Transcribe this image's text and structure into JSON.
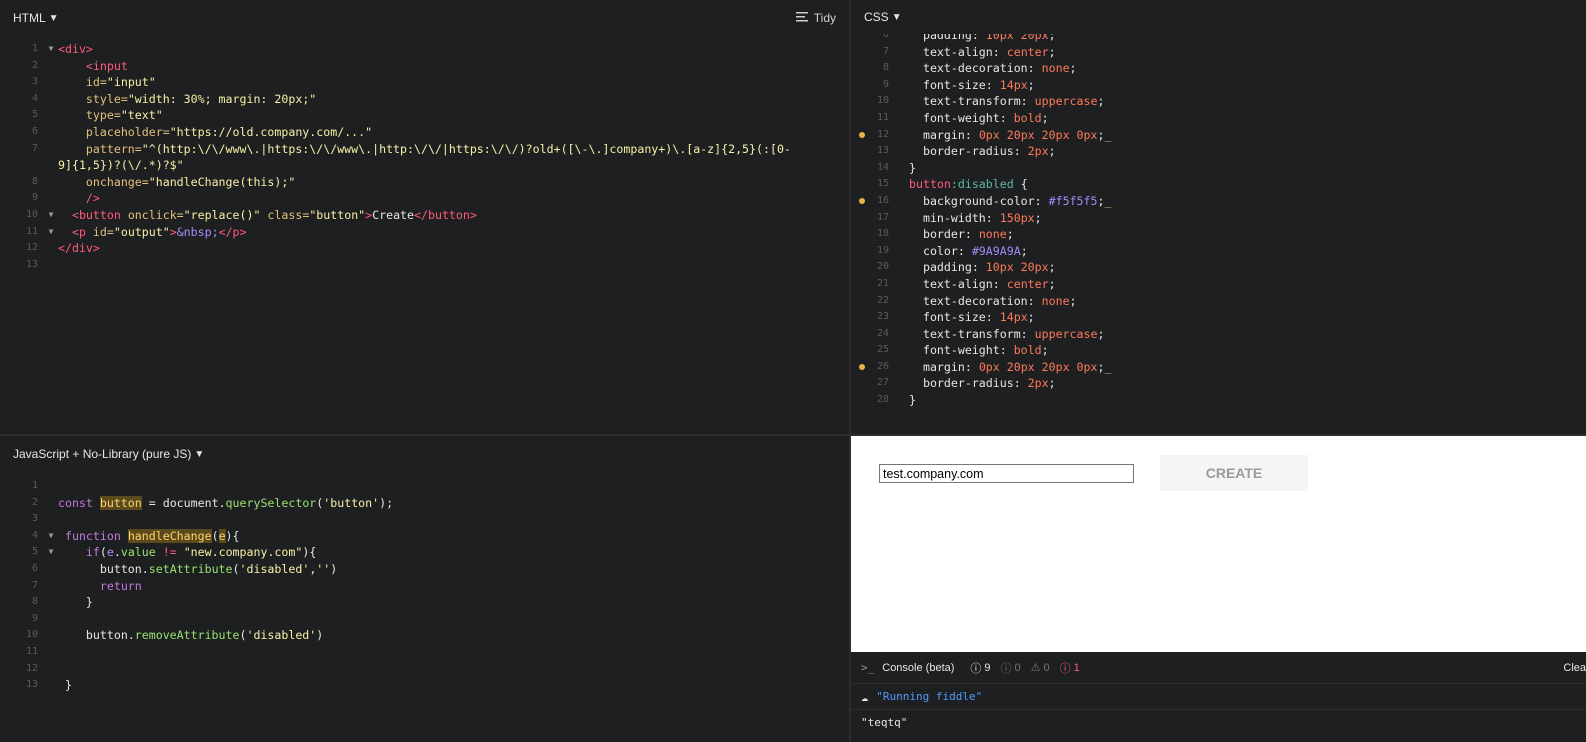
{
  "panels": {
    "html": {
      "title": "HTML",
      "tidy": "Tidy"
    },
    "css": {
      "title": "CSS"
    },
    "js": {
      "title": "JavaScript + No-Library (pure JS)"
    }
  },
  "html_code": [
    {
      "n": "1",
      "fold": true,
      "tokens": [
        [
          "tag",
          "<div"
        ],
        [
          "tag",
          ">"
        ]
      ]
    },
    {
      "n": "2",
      "tokens": [
        [
          "txt",
          "    "
        ],
        [
          "tag",
          "<input"
        ]
      ]
    },
    {
      "n": "3",
      "tokens": [
        [
          "txt",
          "    "
        ],
        [
          "attr",
          "id="
        ],
        [
          "str",
          "\"input\""
        ]
      ]
    },
    {
      "n": "4",
      "tokens": [
        [
          "txt",
          "    "
        ],
        [
          "attr",
          "style="
        ],
        [
          "str",
          "\"width: 30%; margin: 20px;\""
        ]
      ]
    },
    {
      "n": "5",
      "tokens": [
        [
          "txt",
          "    "
        ],
        [
          "attr",
          "type="
        ],
        [
          "str",
          "\"text\""
        ]
      ]
    },
    {
      "n": "6",
      "tokens": [
        [
          "txt",
          "    "
        ],
        [
          "attr",
          "placeholder="
        ],
        [
          "str",
          "\"https://old.company.com/...\""
        ]
      ]
    },
    {
      "n": "7",
      "tokens": [
        [
          "txt",
          "    "
        ],
        [
          "attr",
          "pattern="
        ],
        [
          "str",
          "\"^(http:\\/\\/www\\.|https:\\/\\/www\\.|http:\\/\\/|https:\\/\\/)?old+([\\-\\.]company+)\\.[a-z]{2,5}(:[0-"
        ]
      ]
    },
    {
      "n": "",
      "tokens": [
        [
          "str",
          "9]{1,5})?(\\/.*)?$\""
        ]
      ]
    },
    {
      "n": "8",
      "tokens": [
        [
          "txt",
          "    "
        ],
        [
          "attr",
          "onchange="
        ],
        [
          "str",
          "\"handleChange(this);\""
        ]
      ]
    },
    {
      "n": "9",
      "tokens": [
        [
          "txt",
          "    "
        ],
        [
          "tag",
          "/>"
        ]
      ]
    },
    {
      "n": "10",
      "fold": true,
      "tokens": [
        [
          "txt",
          "  "
        ],
        [
          "tag",
          "<button "
        ],
        [
          "attr",
          "onclick="
        ],
        [
          "str",
          "\"replace()\" "
        ],
        [
          "attr",
          "class="
        ],
        [
          "str",
          "\"button\""
        ],
        [
          "tag",
          ">"
        ],
        [
          "txt",
          "Create"
        ],
        [
          "tag",
          "</button>"
        ]
      ]
    },
    {
      "n": "11",
      "fold": true,
      "tokens": [
        [
          "txt",
          "  "
        ],
        [
          "tag",
          "<p "
        ],
        [
          "attr",
          "id="
        ],
        [
          "str",
          "\"output\""
        ],
        [
          "tag",
          ">"
        ],
        [
          "ent",
          "&nbsp;"
        ],
        [
          "tag",
          "</p>"
        ]
      ]
    },
    {
      "n": "12",
      "tokens": [
        [
          "tag",
          "</div>"
        ]
      ]
    },
    {
      "n": "13",
      "tokens": []
    }
  ],
  "css_code": [
    {
      "n": "6",
      "tokens": [
        [
          "prop",
          "  padding: "
        ],
        [
          "num",
          "10px 20px"
        ],
        [
          "txt",
          ";"
        ]
      ]
    },
    {
      "n": "7",
      "tokens": [
        [
          "prop",
          "  text-align: "
        ],
        [
          "val",
          "center"
        ],
        [
          "txt",
          ";"
        ]
      ]
    },
    {
      "n": "8",
      "tokens": [
        [
          "prop",
          "  text-decoration: "
        ],
        [
          "val",
          "none"
        ],
        [
          "txt",
          ";"
        ]
      ]
    },
    {
      "n": "9",
      "tokens": [
        [
          "prop",
          "  font-size: "
        ],
        [
          "num",
          "14px"
        ],
        [
          "txt",
          ";"
        ]
      ]
    },
    {
      "n": "10",
      "tokens": [
        [
          "prop",
          "  text-transform: "
        ],
        [
          "val",
          "uppercase"
        ],
        [
          "txt",
          ";"
        ]
      ]
    },
    {
      "n": "11",
      "tokens": [
        [
          "prop",
          "  font-weight: "
        ],
        [
          "val",
          "bold"
        ],
        [
          "txt",
          ";"
        ]
      ]
    },
    {
      "n": "12",
      "dot": true,
      "tokens": [
        [
          "prop",
          "  margin: "
        ],
        [
          "num",
          "0px 20px 20px 0px"
        ],
        [
          "txt",
          ";"
        ],
        [
          "attr",
          "_"
        ]
      ]
    },
    {
      "n": "13",
      "tokens": [
        [
          "prop",
          "  border-radius: "
        ],
        [
          "num",
          "2px"
        ],
        [
          "txt",
          ";"
        ]
      ]
    },
    {
      "n": "14",
      "tokens": [
        [
          "txt",
          "}"
        ]
      ]
    },
    {
      "n": "15",
      "tokens": [
        [
          "tag",
          "button"
        ],
        [
          "pseudo",
          ":disabled"
        ],
        [
          "txt",
          " {"
        ]
      ]
    },
    {
      "n": "16",
      "dot": true,
      "tokens": [
        [
          "prop",
          "  background-color: "
        ],
        [
          "ent",
          "#f5f5f5"
        ],
        [
          "txt",
          ";"
        ],
        [
          "attr",
          "_"
        ]
      ]
    },
    {
      "n": "17",
      "tokens": [
        [
          "prop",
          "  min-width: "
        ],
        [
          "num",
          "150px"
        ],
        [
          "txt",
          ";"
        ]
      ]
    },
    {
      "n": "18",
      "tokens": [
        [
          "prop",
          "  border: "
        ],
        [
          "val",
          "none"
        ],
        [
          "txt",
          ";"
        ]
      ]
    },
    {
      "n": "19",
      "tokens": [
        [
          "prop",
          "  color: "
        ],
        [
          "ent",
          "#9A9A9A"
        ],
        [
          "txt",
          ";"
        ]
      ]
    },
    {
      "n": "20",
      "tokens": [
        [
          "prop",
          "  padding: "
        ],
        [
          "num",
          "10px 20px"
        ],
        [
          "txt",
          ";"
        ]
      ]
    },
    {
      "n": "21",
      "tokens": [
        [
          "prop",
          "  text-align: "
        ],
        [
          "val",
          "center"
        ],
        [
          "txt",
          ";"
        ]
      ]
    },
    {
      "n": "22",
      "tokens": [
        [
          "prop",
          "  text-decoration: "
        ],
        [
          "val",
          "none"
        ],
        [
          "txt",
          ";"
        ]
      ]
    },
    {
      "n": "23",
      "tokens": [
        [
          "prop",
          "  font-size: "
        ],
        [
          "num",
          "14px"
        ],
        [
          "txt",
          ";"
        ]
      ]
    },
    {
      "n": "24",
      "tokens": [
        [
          "prop",
          "  text-transform: "
        ],
        [
          "val",
          "uppercase"
        ],
        [
          "txt",
          ";"
        ]
      ]
    },
    {
      "n": "25",
      "tokens": [
        [
          "prop",
          "  font-weight: "
        ],
        [
          "val",
          "bold"
        ],
        [
          "txt",
          ";"
        ]
      ]
    },
    {
      "n": "26",
      "dot": true,
      "tokens": [
        [
          "prop",
          "  margin: "
        ],
        [
          "num",
          "0px 20px 20px 0px"
        ],
        [
          "txt",
          ";"
        ],
        [
          "attr",
          "_"
        ]
      ]
    },
    {
      "n": "27",
      "tokens": [
        [
          "prop",
          "  border-radius: "
        ],
        [
          "num",
          "2px"
        ],
        [
          "txt",
          ";"
        ]
      ]
    },
    {
      "n": "28",
      "tokens": [
        [
          "txt",
          "}"
        ]
      ]
    }
  ],
  "js_code": [
    {
      "n": "1",
      "tokens": []
    },
    {
      "n": "2",
      "tokens": [
        [
          "kw",
          "const "
        ],
        [
          "hl",
          "button"
        ],
        [
          "txt",
          " = document."
        ],
        [
          "fn",
          "querySelector"
        ],
        [
          "txt",
          "("
        ],
        [
          "str",
          "'button'"
        ],
        [
          "txt",
          ");"
        ]
      ]
    },
    {
      "n": "3",
      "tokens": []
    },
    {
      "n": "4",
      "fold": true,
      "tokens": [
        [
          "kw",
          " function "
        ],
        [
          "hl",
          "handleChange"
        ],
        [
          "txt",
          "("
        ],
        [
          "hl",
          "e"
        ],
        [
          "txt",
          "){"
        ]
      ]
    },
    {
      "n": "5",
      "fold": true,
      "tokens": [
        [
          "txt",
          "    "
        ],
        [
          "kw",
          "if"
        ],
        [
          "txt",
          "("
        ],
        [
          "ent",
          "e"
        ],
        [
          "txt",
          "."
        ],
        [
          "fn",
          "value"
        ],
        [
          "txt",
          " "
        ],
        [
          "tag",
          "!="
        ],
        [
          "txt",
          " "
        ],
        [
          "str",
          "\"new.company.com\""
        ],
        [
          "txt",
          "){"
        ]
      ]
    },
    {
      "n": "6",
      "tokens": [
        [
          "txt",
          "      button."
        ],
        [
          "fn",
          "setAttribute"
        ],
        [
          "txt",
          "("
        ],
        [
          "str",
          "'disabled'"
        ],
        [
          "txt",
          ","
        ],
        [
          "str",
          "''"
        ],
        [
          "txt",
          ")"
        ]
      ]
    },
    {
      "n": "7",
      "tokens": [
        [
          "txt",
          "      "
        ],
        [
          "kw",
          "return"
        ]
      ]
    },
    {
      "n": "8",
      "tokens": [
        [
          "txt",
          "    }"
        ]
      ]
    },
    {
      "n": "9",
      "tokens": []
    },
    {
      "n": "10",
      "tokens": [
        [
          "txt",
          "    button."
        ],
        [
          "fn",
          "removeAttribute"
        ],
        [
          "txt",
          "("
        ],
        [
          "str",
          "'disabled'"
        ],
        [
          "txt",
          ")"
        ]
      ]
    },
    {
      "n": "11",
      "tokens": []
    },
    {
      "n": "12",
      "tokens": []
    },
    {
      "n": "13",
      "tokens": [
        [
          "txt",
          " }"
        ]
      ]
    }
  ],
  "result": {
    "input_value": "test.company.com",
    "button_label": "Create"
  },
  "console": {
    "title": "Console (beta)",
    "info_count": "9",
    "log_count": "0",
    "warn_count": "0",
    "error_count": "1",
    "clear_label": "Clea",
    "rows": [
      "\"Running fiddle\"",
      "\"teqtq\""
    ]
  },
  "colors": {
    "accent_dot": "#e8b344",
    "error": "#ff5b79",
    "info_link": "#4e9bff"
  }
}
